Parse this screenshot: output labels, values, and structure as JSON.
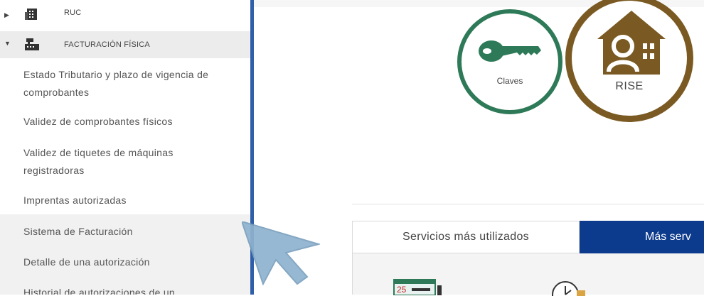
{
  "sidebar": {
    "sections": [
      {
        "label": "RUC",
        "icon": "building-icon",
        "expanded": false
      },
      {
        "label": "FACTURACIÓN FÍSICA",
        "icon": "cash-register-icon",
        "expanded": true
      }
    ],
    "links": [
      "Estado Tributario y plazo de vigencia de",
      "comprobantes",
      "Validez de comprobantes físicos",
      "Validez de tiquetes de máquinas",
      "registradoras",
      "Imprentas autorizadas",
      "Sistema de Facturación",
      "Detalle de una autorización",
      "Historial de autorizaciones de un"
    ]
  },
  "tiles": [
    {
      "label": "Claves",
      "icon": "key-icon",
      "color": "#2e7a58"
    },
    {
      "label": "RISE",
      "icon": "house-user-icon",
      "color": "#7a5a22"
    }
  ],
  "tabs": [
    {
      "label": "Servicios más utilizados",
      "active": false
    },
    {
      "label": "Más serv",
      "active": true
    }
  ],
  "panel_icons": [
    {
      "label": "25",
      "icon": "calendar-icon"
    },
    {
      "icon": "clock-icon"
    }
  ],
  "colors": {
    "sidebar_accent": "#2f5fa8",
    "tab_active": "#0c3a8c"
  }
}
